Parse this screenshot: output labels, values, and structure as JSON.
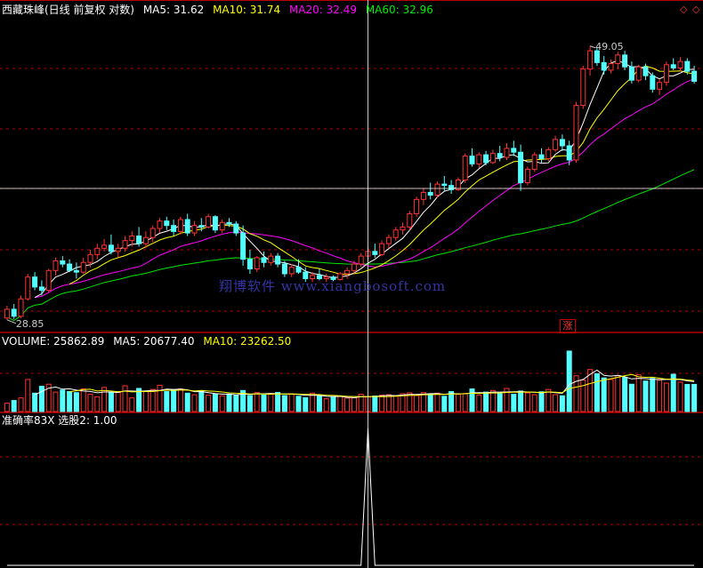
{
  "header": {
    "stock_title": "西藏珠峰(日线 前复权 对数)",
    "ma5": "MA5: 31.62",
    "ma10": "MA10: 31.74",
    "ma20": "MA20: 32.49",
    "ma60": "MA60: 32.96"
  },
  "volume_panel": {
    "volume": "VOLUME: 25862.89",
    "ma5": "MA5: 20677.40",
    "ma10": "MA10: 23262.50"
  },
  "indicator_panel": {
    "label": "准确率83X 选股2: 1.00"
  },
  "watermark": "翔博软件 www.xiangbosoft.com",
  "badge": "涨",
  "colors": {
    "up": "#ff3232",
    "down": "#54ffff",
    "ma5": "#ffffff",
    "ma10": "#ffff00",
    "ma20": "#ff00ff",
    "ma60": "#00e600",
    "grid": "#b40000",
    "crosshair": "#ffffff"
  },
  "chart_data": [
    {
      "type": "candlestick",
      "name": "price",
      "scale": "log",
      "ylim": [
        28.2,
        52.0
      ],
      "annotations": {
        "max_label": "49.05",
        "max_value": 49.05,
        "min_label": "28.85",
        "min_value": 28.85
      },
      "ohlc": [
        [
          28.9,
          29.6,
          28.8,
          29.4
        ],
        [
          29.4,
          29.7,
          28.85,
          29.0
        ],
        [
          29.0,
          30.2,
          28.9,
          30.0
        ],
        [
          30.0,
          31.5,
          29.9,
          31.3
        ],
        [
          31.3,
          31.6,
          30.5,
          30.7
        ],
        [
          30.7,
          31.1,
          30.2,
          30.5
        ],
        [
          30.5,
          31.8,
          30.4,
          31.7
        ],
        [
          31.7,
          32.5,
          31.4,
          32.3
        ],
        [
          32.3,
          32.6,
          31.9,
          32.1
        ],
        [
          32.1,
          32.4,
          31.6,
          31.7
        ],
        [
          31.7,
          32.2,
          31.2,
          31.6
        ],
        [
          31.6,
          32.5,
          31.5,
          32.2
        ],
        [
          32.2,
          33.0,
          31.9,
          32.7
        ],
        [
          32.7,
          33.4,
          32.4,
          33.1
        ],
        [
          33.1,
          33.7,
          32.9,
          33.3
        ],
        [
          33.3,
          34.0,
          32.7,
          32.9
        ],
        [
          32.9,
          33.4,
          32.5,
          33.1
        ],
        [
          33.1,
          33.9,
          32.9,
          33.6
        ],
        [
          33.6,
          34.2,
          33.2,
          33.9
        ],
        [
          33.9,
          34.5,
          33.2,
          33.4
        ],
        [
          33.4,
          34.2,
          33.1,
          33.8
        ],
        [
          33.8,
          34.6,
          33.5,
          34.4
        ],
        [
          34.4,
          35.1,
          34.1,
          34.9
        ],
        [
          34.9,
          35.2,
          34.3,
          34.6
        ],
        [
          34.6,
          35.0,
          33.9,
          34.2
        ],
        [
          34.2,
          35.2,
          34.0,
          35.0
        ],
        [
          35.0,
          35.4,
          33.9,
          34.1
        ],
        [
          34.1,
          34.9,
          33.9,
          34.6
        ],
        [
          34.6,
          35.1,
          34.2,
          34.5
        ],
        [
          34.5,
          35.4,
          34.4,
          35.2
        ],
        [
          35.2,
          35.3,
          34.1,
          34.3
        ],
        [
          34.3,
          35.0,
          34.1,
          34.8
        ],
        [
          34.8,
          35.1,
          34.5,
          34.7
        ],
        [
          34.7,
          34.9,
          33.9,
          34.1
        ],
        [
          34.1,
          34.6,
          32.0,
          32.4
        ],
        [
          32.4,
          33.0,
          31.5,
          31.8
        ],
        [
          31.8,
          32.6,
          31.6,
          32.5
        ],
        [
          32.5,
          32.9,
          31.9,
          32.2
        ],
        [
          32.2,
          32.8,
          32.0,
          32.6
        ],
        [
          32.6,
          32.8,
          31.9,
          32.1
        ],
        [
          32.1,
          32.3,
          31.3,
          31.5
        ],
        [
          31.5,
          32.1,
          31.3,
          31.9
        ],
        [
          31.9,
          32.4,
          31.5,
          31.6
        ],
        [
          31.6,
          31.9,
          31.0,
          31.2
        ],
        [
          31.2,
          31.6,
          31.0,
          31.4
        ],
        [
          31.4,
          31.8,
          31.1,
          31.2
        ],
        [
          31.2,
          31.5,
          31.0,
          31.3
        ],
        [
          31.3,
          31.4,
          31.05,
          31.15
        ],
        [
          31.15,
          31.6,
          31.1,
          31.5
        ],
        [
          31.5,
          31.9,
          31.2,
          31.7
        ],
        [
          31.7,
          32.3,
          31.5,
          32.1
        ],
        [
          32.1,
          32.8,
          31.9,
          32.6
        ],
        [
          32.6,
          33.2,
          32.3,
          32.9
        ],
        [
          32.9,
          33.4,
          32.5,
          32.7
        ],
        [
          32.7,
          33.6,
          32.6,
          33.4
        ],
        [
          33.4,
          34.0,
          33.1,
          33.8
        ],
        [
          33.8,
          34.5,
          33.6,
          34.3
        ],
        [
          34.3,
          34.8,
          34.0,
          34.5
        ],
        [
          34.5,
          35.6,
          34.3,
          35.4
        ],
        [
          35.4,
          36.6,
          35.2,
          36.4
        ],
        [
          36.4,
          37.2,
          36.0,
          36.9
        ],
        [
          36.9,
          37.6,
          36.4,
          36.7
        ],
        [
          36.7,
          37.7,
          36.5,
          37.5
        ],
        [
          37.5,
          38.1,
          37.0,
          37.4
        ],
        [
          37.4,
          37.8,
          36.8,
          37.1
        ],
        [
          37.1,
          38.0,
          37.0,
          37.8
        ],
        [
          37.8,
          39.8,
          37.6,
          39.6
        ],
        [
          39.6,
          40.2,
          38.8,
          39.0
        ],
        [
          39.0,
          39.9,
          38.7,
          39.7
        ],
        [
          39.7,
          40.0,
          38.9,
          39.1
        ],
        [
          39.1,
          40.1,
          39.0,
          39.8
        ],
        [
          39.8,
          40.4,
          39.2,
          39.5
        ],
        [
          39.5,
          40.6,
          39.3,
          40.2
        ],
        [
          40.2,
          40.8,
          39.6,
          39.9
        ],
        [
          39.9,
          40.5,
          37.0,
          37.6
        ],
        [
          37.6,
          38.8,
          37.4,
          38.6
        ],
        [
          38.6,
          39.9,
          38.4,
          39.7
        ],
        [
          39.7,
          40.2,
          39.1,
          39.4
        ],
        [
          39.4,
          40.3,
          39.2,
          40.1
        ],
        [
          40.1,
          41.2,
          39.9,
          40.9
        ],
        [
          40.9,
          41.3,
          40.0,
          40.4
        ],
        [
          40.4,
          40.8,
          38.9,
          39.3
        ],
        [
          39.3,
          44.0,
          39.1,
          43.7
        ],
        [
          43.7,
          47.2,
          43.4,
          46.9
        ],
        [
          46.9,
          49.05,
          46.3,
          48.6
        ],
        [
          48.6,
          48.9,
          47.2,
          47.5
        ],
        [
          47.5,
          48.1,
          46.4,
          46.8
        ],
        [
          46.8,
          47.8,
          46.5,
          47.4
        ],
        [
          47.4,
          48.5,
          46.9,
          48.2
        ],
        [
          48.2,
          48.6,
          46.8,
          47.1
        ],
        [
          47.1,
          47.6,
          45.6,
          45.9
        ],
        [
          45.9,
          47.3,
          45.7,
          47.1
        ],
        [
          47.1,
          47.4,
          45.9,
          46.3
        ],
        [
          46.3,
          46.6,
          44.8,
          45.1
        ],
        [
          45.1,
          46.0,
          44.6,
          45.7
        ],
        [
          45.7,
          47.6,
          45.4,
          47.3
        ],
        [
          47.3,
          47.9,
          46.8,
          47.0
        ],
        [
          47.0,
          48.0,
          46.7,
          47.6
        ],
        [
          47.6,
          47.9,
          46.4,
          46.7
        ],
        [
          46.7,
          47.2,
          45.6,
          45.8
        ]
      ]
    },
    {
      "type": "bar",
      "name": "VOLUME",
      "ylim": [
        0,
        60000
      ],
      "values": [
        8000,
        10500,
        13000,
        30500,
        17500,
        24000,
        26000,
        18500,
        20500,
        19000,
        18000,
        21500,
        16500,
        14000,
        23000,
        18000,
        19000,
        24500,
        13000,
        22000,
        19500,
        21000,
        25000,
        19000,
        20500,
        21500,
        17500,
        16000,
        19500,
        15500,
        16800,
        15000,
        16500,
        15200,
        20000,
        15300,
        18000,
        15800,
        17000,
        18200,
        15200,
        16800,
        14500,
        13200,
        17500,
        14800,
        12200,
        13500,
        14300,
        12800,
        13200,
        16400,
        14200,
        14800,
        15600,
        16000,
        15000,
        17000,
        17800,
        15200,
        18000,
        16800,
        17500,
        14500,
        19000,
        16500,
        17200,
        21500,
        15500,
        18500,
        20000,
        17000,
        22000,
        16500,
        19500,
        17800,
        16000,
        18800,
        21000,
        16000,
        15000,
        57500,
        34000,
        30000,
        40000,
        36000,
        32000,
        30500,
        34000,
        32500,
        26000,
        35000,
        29000,
        31500,
        30000,
        27000,
        35500,
        28000,
        25800,
        25862
      ]
    },
    {
      "type": "line",
      "name": "选股2",
      "ylim": [
        0,
        1
      ],
      "values": [
        0,
        0,
        0,
        0,
        0,
        0,
        0,
        0,
        0,
        0,
        0,
        0,
        0,
        0,
        0,
        0,
        0,
        0,
        0,
        0,
        0,
        0,
        0,
        0,
        0,
        0,
        0,
        0,
        0,
        0,
        0,
        0,
        0,
        0,
        0,
        0,
        0,
        0,
        0,
        0,
        0,
        0,
        0,
        0,
        0,
        0,
        0,
        0,
        0,
        0,
        0,
        0,
        1,
        0,
        0,
        0,
        0,
        0,
        0,
        0,
        0,
        0,
        0,
        0,
        0,
        0,
        0,
        0,
        0,
        0,
        0,
        0,
        0,
        0,
        0,
        0,
        0,
        0,
        0,
        0,
        0,
        0,
        0,
        0,
        0,
        0,
        0,
        0,
        0,
        0,
        0,
        0,
        0,
        0,
        0,
        0,
        0,
        0,
        0,
        0
      ]
    }
  ]
}
